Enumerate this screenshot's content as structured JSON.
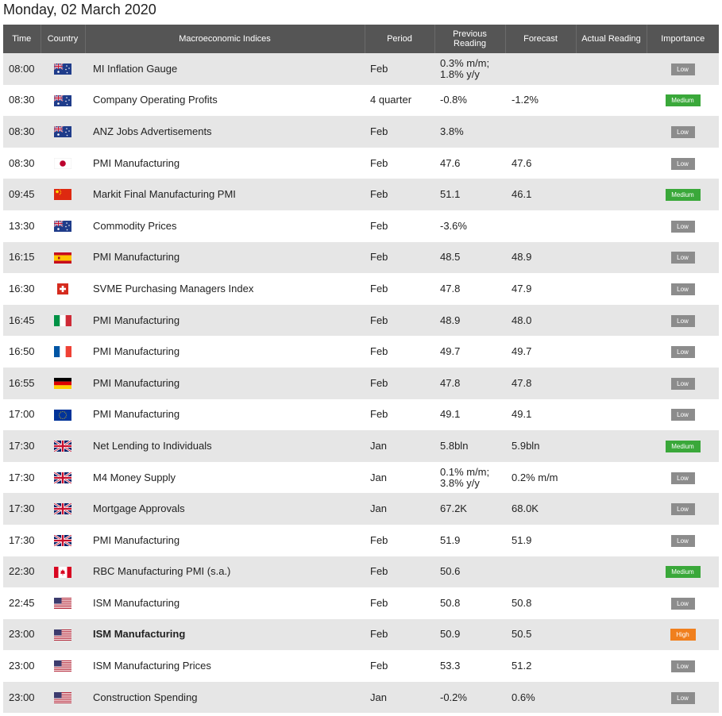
{
  "page": {
    "title": "Monday, 02 March 2020"
  },
  "columns": {
    "time": "Time",
    "country": "Country",
    "index": "Macroeconomic Indices",
    "period": "Period",
    "previous": "Previous Reading",
    "forecast": "Forecast",
    "actual": "Actual Reading",
    "importance": "Importance"
  },
  "colors": {
    "low": "#8c8c8c",
    "medium": "#3aa83a",
    "high": "#f07f1d",
    "header": "#555555"
  },
  "rows": [
    {
      "time": "08:00",
      "flag": "au",
      "index": "MI Inflation Gauge",
      "period": "Feb",
      "previous": "0.3% m/m; 1.8% y/y",
      "forecast": "",
      "actual": "",
      "importance": "Low",
      "level": "low"
    },
    {
      "time": "08:30",
      "flag": "au",
      "index": "Company Operating Profits",
      "period": "4 quarter",
      "previous": "-0.8%",
      "forecast": "-1.2%",
      "actual": "",
      "importance": "Medium",
      "level": "medium"
    },
    {
      "time": "08:30",
      "flag": "au",
      "index": "ANZ Jobs Advertisements",
      "period": "Feb",
      "previous": "3.8%",
      "forecast": "",
      "actual": "",
      "importance": "Low",
      "level": "low"
    },
    {
      "time": "08:30",
      "flag": "jp",
      "index": "PMI Manufacturing",
      "period": "Feb",
      "previous": "47.6",
      "forecast": "47.6",
      "actual": "",
      "importance": "Low",
      "level": "low"
    },
    {
      "time": "09:45",
      "flag": "cn",
      "index": "Markit Final Manufacturing PMI",
      "period": "Feb",
      "previous": "51.1",
      "forecast": "46.1",
      "actual": "",
      "importance": "Medium",
      "level": "medium"
    },
    {
      "time": "13:30",
      "flag": "au",
      "index": "Commodity Prices",
      "period": "Feb",
      "previous": "-3.6%",
      "forecast": "",
      "actual": "",
      "importance": "Low",
      "level": "low"
    },
    {
      "time": "16:15",
      "flag": "es",
      "index": "PMI Manufacturing",
      "period": "Feb",
      "previous": "48.5",
      "forecast": "48.9",
      "actual": "",
      "importance": "Low",
      "level": "low"
    },
    {
      "time": "16:30",
      "flag": "ch",
      "index": "SVME Purchasing Managers Index",
      "period": "Feb",
      "previous": "47.8",
      "forecast": "47.9",
      "actual": "",
      "importance": "Low",
      "level": "low"
    },
    {
      "time": "16:45",
      "flag": "it",
      "index": "PMI Manufacturing",
      "period": "Feb",
      "previous": "48.9",
      "forecast": "48.0",
      "actual": "",
      "importance": "Low",
      "level": "low"
    },
    {
      "time": "16:50",
      "flag": "fr",
      "index": "PMI Manufacturing",
      "period": "Feb",
      "previous": "49.7",
      "forecast": "49.7",
      "actual": "",
      "importance": "Low",
      "level": "low"
    },
    {
      "time": "16:55",
      "flag": "de",
      "index": "PMI Manufacturing",
      "period": "Feb",
      "previous": "47.8",
      "forecast": "47.8",
      "actual": "",
      "importance": "Low",
      "level": "low"
    },
    {
      "time": "17:00",
      "flag": "eu",
      "index": "PMI Manufacturing",
      "period": "Feb",
      "previous": "49.1",
      "forecast": "49.1",
      "actual": "",
      "importance": "Low",
      "level": "low"
    },
    {
      "time": "17:30",
      "flag": "gb",
      "index": "Net Lending to Individuals",
      "period": "Jan",
      "previous": "5.8bln",
      "forecast": "5.9bln",
      "actual": "",
      "importance": "Medium",
      "level": "medium"
    },
    {
      "time": "17:30",
      "flag": "gb",
      "index": "M4 Money Supply",
      "period": "Jan",
      "previous": "0.1% m/m; 3.8% y/y",
      "forecast": "0.2% m/m",
      "actual": "",
      "importance": "Low",
      "level": "low"
    },
    {
      "time": "17:30",
      "flag": "gb",
      "index": "Mortgage Approvals",
      "period": "Jan",
      "previous": "67.2K",
      "forecast": "68.0K",
      "actual": "",
      "importance": "Low",
      "level": "low"
    },
    {
      "time": "17:30",
      "flag": "gb",
      "index": "PMI Manufacturing",
      "period": "Feb",
      "previous": "51.9",
      "forecast": "51.9",
      "actual": "",
      "importance": "Low",
      "level": "low"
    },
    {
      "time": "22:30",
      "flag": "ca",
      "index": "RBC Manufacturing PMI (s.a.)",
      "period": "Feb",
      "previous": "50.6",
      "forecast": "",
      "actual": "",
      "importance": "Medium",
      "level": "medium"
    },
    {
      "time": "22:45",
      "flag": "us",
      "index": "ISM Manufacturing",
      "period": "Feb",
      "previous": "50.8",
      "forecast": "50.8",
      "actual": "",
      "importance": "Low",
      "level": "low"
    },
    {
      "time": "23:00",
      "flag": "us",
      "index": "ISM Manufacturing",
      "period": "Feb",
      "previous": "50.9",
      "forecast": "50.5",
      "actual": "",
      "importance": "High",
      "level": "high"
    },
    {
      "time": "23:00",
      "flag": "us",
      "index": "ISM Manufacturing Prices",
      "period": "Feb",
      "previous": "53.3",
      "forecast": "51.2",
      "actual": "",
      "importance": "Low",
      "level": "low"
    },
    {
      "time": "23:00",
      "flag": "us",
      "index": "Construction Spending",
      "period": "Jan",
      "previous": "-0.2%",
      "forecast": "0.6%",
      "actual": "",
      "importance": "Low",
      "level": "low"
    }
  ]
}
